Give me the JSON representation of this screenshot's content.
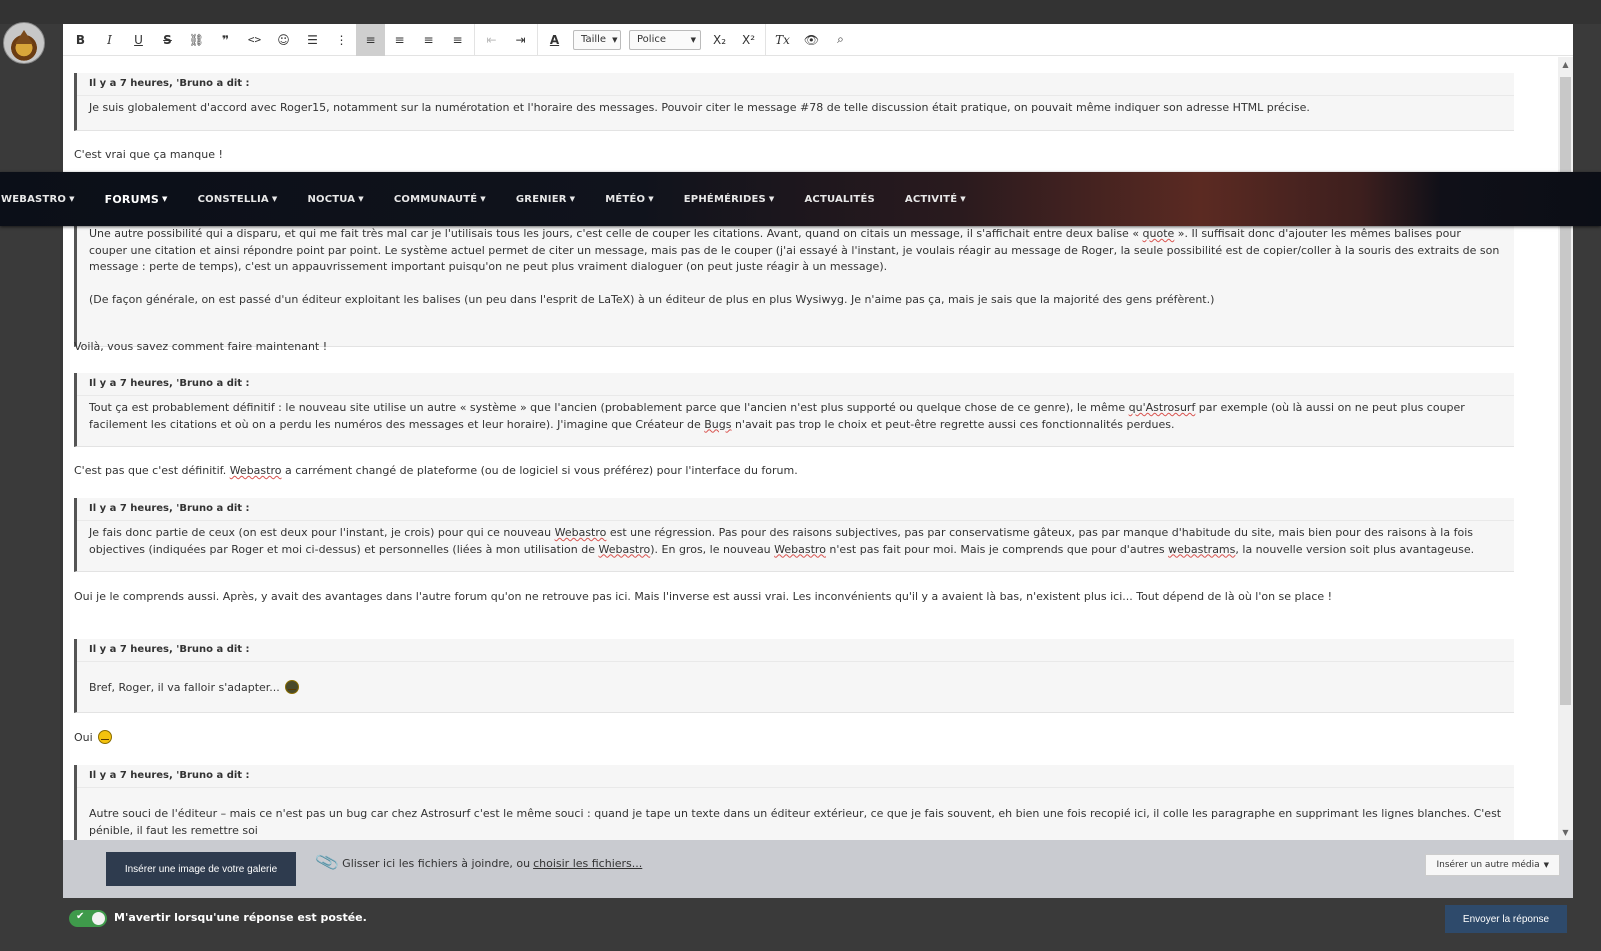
{
  "toolbar": {
    "bold": "B",
    "italic": "I",
    "underline": "U",
    "strike": "S",
    "link": "⛓",
    "quote": "❞",
    "code": "<>",
    "emoji": "☺",
    "bullets": "☰",
    "numbered": "⋮",
    "align_left": "≡",
    "align_center": "≡",
    "align_right": "≡",
    "justify": "≡",
    "outdent": "⇤",
    "indent": "⇥",
    "text_color": "A",
    "size_label": "Taille",
    "font_label": "Police",
    "subscript": "X₂",
    "superscript": "X²",
    "remove_format": "Tx",
    "preview": "👁",
    "source": "⌕"
  },
  "nav": {
    "items": [
      {
        "label": "WEBASTRO",
        "active": false
      },
      {
        "label": "FORUMS",
        "active": true
      },
      {
        "label": "CONSTELLIA",
        "active": false
      },
      {
        "label": "NOCTUA",
        "active": false
      },
      {
        "label": "COMMUNAUTÉ",
        "active": false
      },
      {
        "label": "GRENIER",
        "active": false
      },
      {
        "label": "MÉTÉO",
        "active": false
      },
      {
        "label": "EPHÉMÉRIDES",
        "active": false
      },
      {
        "label": "ACTUALITÉS",
        "active": false
      },
      {
        "label": "ACTIVITÉ",
        "active": false
      }
    ]
  },
  "content": {
    "q1_head": "Il y a 7 heures, 'Bruno a dit :",
    "q1_text": "Je suis globalement d'accord avec Roger15, notamment sur la numérotation et l'horaire des messages. Pouvoir citer le message #78 de telle discussion était pratique, on pouvait même indiquer son adresse HTML précise.",
    "p1": "C'est vrai que ça manque !",
    "q2_line1_pre": "Une autre possibilité qui a disparu, et qui me fait très mal car je l'utilisais tous les jours, c'est celle de couper les citations. Avant, quand on citais un message, il s'affichait entre deux balise « ",
    "q2_line1_word": "quote",
    "q2_line1_post": " ». Il suffisait donc d'ajouter les mêmes balises pour couper une citation et ainsi répondre point par point. Le système actuel permet de citer un message, mais pas de le couper (j'ai essayé à l'instant, je voulais réagir au message de Roger, la seule possibilité est de copier/coller à la souris des extraits de son message : perte de temps), c'est un appauvrissement important puisqu'on ne peut plus vraiment dialoguer (on peut juste réagir à un message).",
    "q2_text2": "(De façon générale, on est passé d'un éditeur exploitant les balises (un peu dans l'esprit de LaTeX) à un éditeur de plus en plus Wysiwyg. Je n'aime pas ça, mais je sais que la majorité des gens préfèrent.)",
    "p2": "Voilà, vous savez comment faire maintenant !",
    "q3_head": "Il y a 7 heures, 'Bruno a dit :",
    "q3_pre": "Tout ça est probablement définitif : le nouveau site utilise un autre « système » que l'ancien (probablement parce que l'ancien n'est plus supporté ou quelque chose de ce genre), le même ",
    "q3_word1": "qu'Astrosurf",
    "q3_mid": " par exemple (où là aussi on ne peut plus couper facilement les citations et où on a perdu les numéros des messages et leur horaire). J'imagine que Créateur de ",
    "q3_word2": "Bugs",
    "q3_post": " n'avait pas trop le choix et peut-être regrette aussi ces fonctionnalités perdues.",
    "p3_pre": "C'est pas que c'est définitif. ",
    "p3_word": "Webastro",
    "p3_post": " a carrément changé de plateforme (ou de logiciel si vous préférez) pour l'interface du forum.",
    "q4_head": "Il y a 7 heures, 'Bruno a dit :",
    "q4_a": "Je fais donc partie de ceux (on est deux pour l'instant, je crois) pour qui ce nouveau ",
    "q4_w1": "Webastro",
    "q4_b": " est une régression. Pas pour des raisons subjectives, pas par conservatisme gâteux, pas par manque d'habitude du site, mais bien pour des raisons à la fois objectives (indiquées par Roger et moi ci-dessus) et personnelles (liées à mon utilisation de ",
    "q4_w2": "Webastro",
    "q4_c": "). En gros, le nouveau ",
    "q4_w3": "Webastro",
    "q4_d": " n'est pas fait pour moi. Mais je comprends que pour d'autres ",
    "q4_w4": "webastrams",
    "q4_e": ", la nouvelle version soit plus avantageuse.",
    "p4": "Oui je le comprends aussi. Après, y avait des avantages dans l'autre forum qu'on ne retrouve pas ici. Mais l'inverse est aussi vrai. Les inconvénients qu'il y a avaient là bas, n'existent plus ici... Tout dépend de là où l'on se place !",
    "q5_head": "Il y a 7 heures, 'Bruno a dit :",
    "q5_text": "Bref, Roger, il va falloir s'adapter...",
    "p5": "Oui",
    "q6_head": "Il y a 7 heures, 'Bruno a dit :",
    "q6_text": "Autre souci de l'éditeur – mais ce n'est pas un bug car chez Astrosurf c'est le même souci : quand je tape un texte dans un éditeur extérieur, ce que je fais souvent, eh bien une fois recopié ici, il colle les paragraphe en supprimant les lignes blanches. C'est pénible, il faut les remettre soi"
  },
  "attach": {
    "gallery_button": "Insérer une image de votre galerie",
    "drop_text": "Glisser ici les fichiers à joindre, ou",
    "choose_link": "choisir les fichiers...",
    "media_button": "Insérer un autre média"
  },
  "footer": {
    "notify_label": "M'avertir lorsqu'une réponse est postée.",
    "send_button": "Envoyer la réponse"
  },
  "colors": {
    "accent": "#2e4a6b",
    "toggle_on": "#3f9a4b"
  }
}
